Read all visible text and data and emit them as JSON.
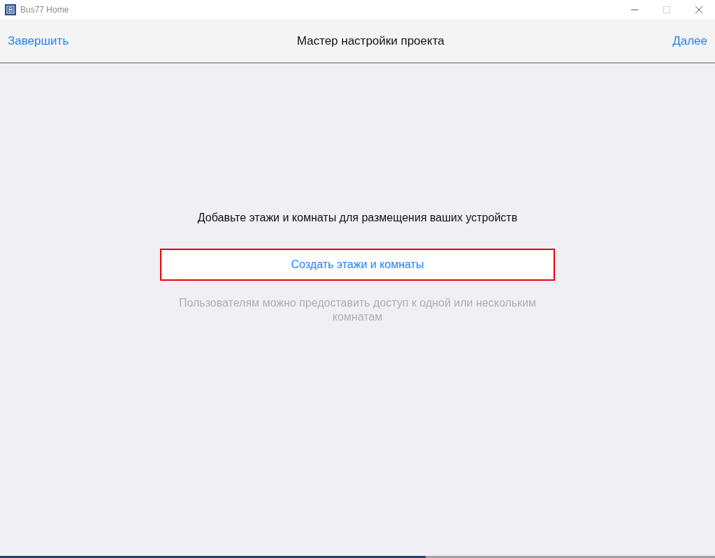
{
  "window": {
    "title": "Bus77 Home",
    "maximize_disabled": true
  },
  "nav": {
    "left": "Завершить",
    "title": "Мастер настройки проекта",
    "right": "Далее"
  },
  "content": {
    "prompt": "Добавьте этажи и комнаты для размещения ваших устройств",
    "button": "Создать этажи и комнаты",
    "hint": "Пользователям можно предоставить доступ к одной или нескольким комнатам"
  },
  "progress": {
    "level": 0.595
  }
}
